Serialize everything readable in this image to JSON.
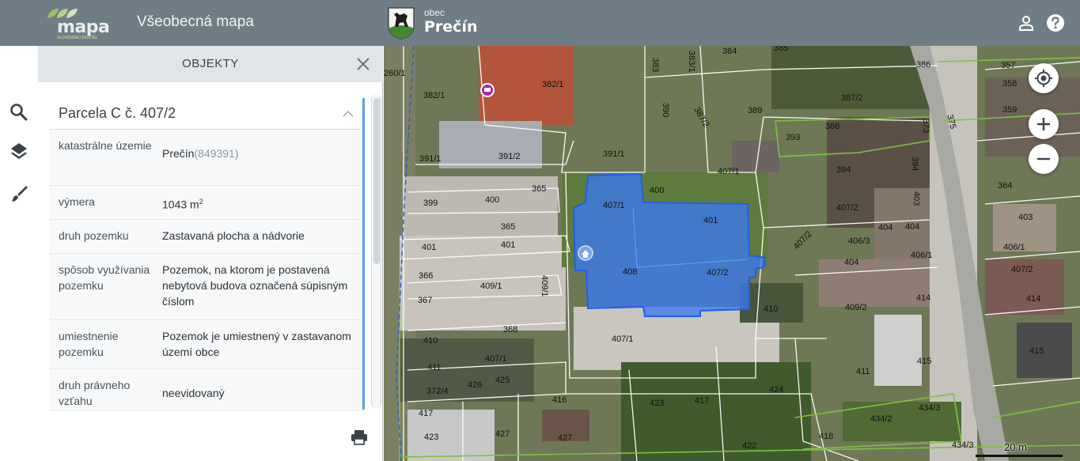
{
  "header": {
    "logo_text": "mapa",
    "logo_tagline": "SLOVENSKO DIGITÁL",
    "app_title": "Všeobecná mapa",
    "municipality_caption": "obec",
    "municipality_name": "Prečín",
    "icons": [
      "user-icon",
      "help-icon"
    ]
  },
  "panel": {
    "title": "OBJEKTY",
    "tools": [
      "search-icon",
      "layers-icon",
      "brush-icon"
    ],
    "card": {
      "title": "Parcela C č. 407/2",
      "rows": [
        {
          "label": "katastrálne územie",
          "value": "Prečín",
          "extra": "(849391)"
        },
        {
          "label": "výmera",
          "value": "1043 m",
          "sup": "2"
        },
        {
          "label": "druh pozemku",
          "value": "Zastavaná plocha a nádvorie"
        },
        {
          "label": "spôsob využívania pozemku",
          "value": "Pozemok, na ktorom je postavená nebytová budova označená súpisným číslom"
        },
        {
          "label": "umiestnenie pozemku",
          "value": "Pozemok je umiestnený v zastavanom území obce"
        },
        {
          "label": "druh právneho vzťahu",
          "value": "neevidovaný"
        }
      ]
    },
    "print_icon": "print-icon"
  },
  "map": {
    "controls": [
      "locate-icon",
      "zoom-in-icon",
      "zoom-out-icon"
    ],
    "scale_label": "20 m",
    "selected_parcel": "407/2",
    "parcel_labels": [
      "260/1",
      "382/1",
      "382/1",
      "383",
      "383/1",
      "384",
      "385",
      "386",
      "357",
      "358",
      "359",
      "387/2",
      "389",
      "390",
      "387/2",
      "388",
      "393",
      "373",
      "375",
      "391/1",
      "391/2",
      "391/1",
      "407/1",
      "394",
      "394",
      "364",
      "365",
      "399",
      "400",
      "400",
      "407/1",
      "407/2",
      "403",
      "403",
      "365",
      "401",
      "401",
      "401",
      "407/2",
      "406/3",
      "404",
      "404",
      "404",
      "406/1",
      "406/1",
      "366",
      "409/1",
      "409/1",
      "408",
      "407/2",
      "407/2",
      "367",
      "409/2",
      "414",
      "414",
      "368",
      "410",
      "410",
      "407/1",
      "407/1",
      "411",
      "411",
      "415",
      "415",
      "372/4",
      "426",
      "425",
      "424",
      "416",
      "423",
      "417",
      "417",
      "423",
      "427",
      "427",
      "422",
      "418",
      "434/2",
      "434/3",
      "434/3",
      "435"
    ],
    "colors": {
      "selection_fill": "#3b78f0",
      "selection_stroke": "#1f5fe8",
      "cadastre_lines": "#ffffff",
      "zoning_lines": "#7dc142"
    }
  }
}
